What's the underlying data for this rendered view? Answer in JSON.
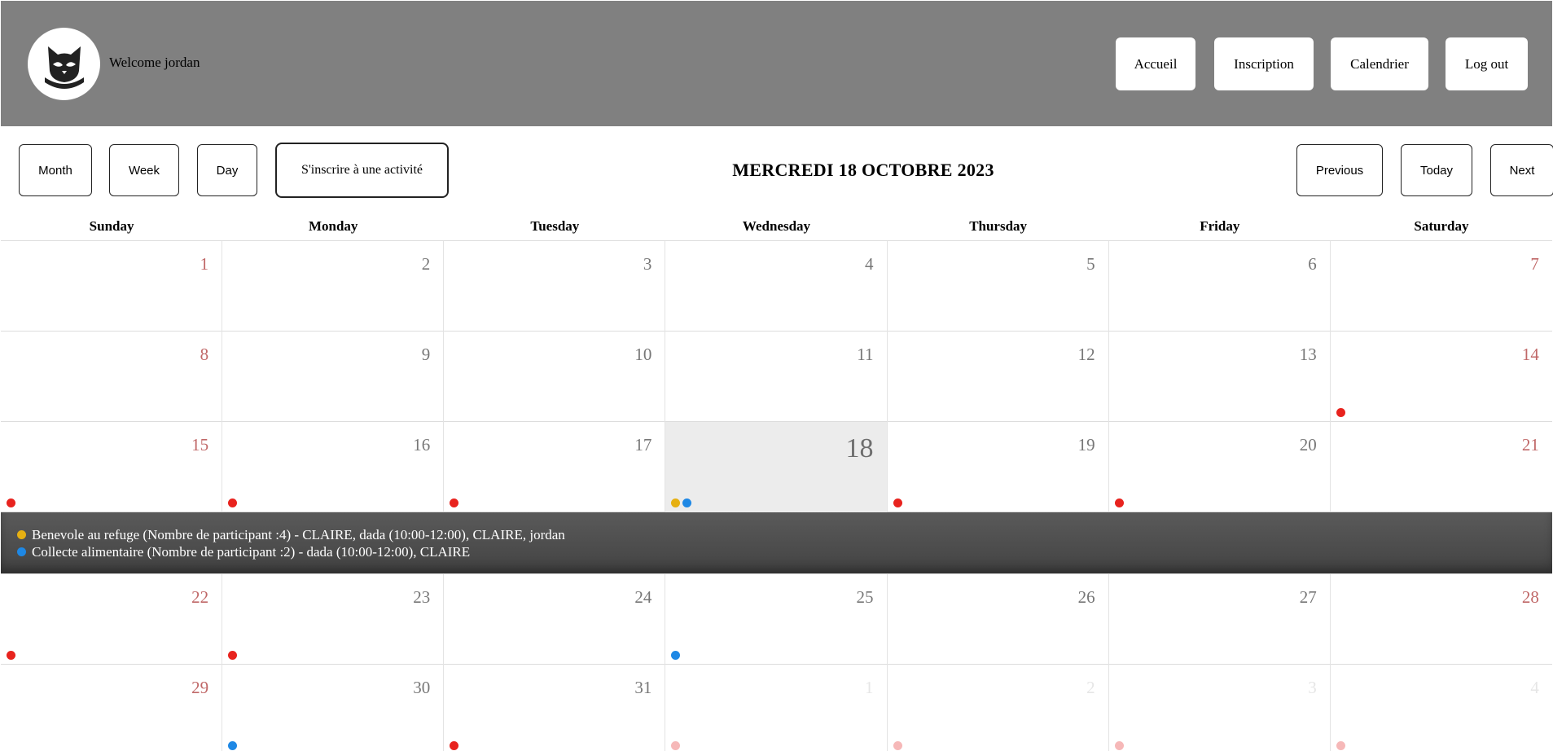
{
  "header": {
    "welcome": "Welcome jordan",
    "nav": [
      "Accueil",
      "Inscription",
      "Calendrier",
      "Log out"
    ]
  },
  "toolbar": {
    "month": "Month",
    "week": "Week",
    "day": "Day",
    "subscribe": "S'inscrire à une activité",
    "title": "MERCREDI 18 OCTOBRE 2023",
    "previous": "Previous",
    "today": "Today",
    "next": "Next"
  },
  "weekdays": [
    "Sunday",
    "Monday",
    "Tuesday",
    "Wednesday",
    "Thursday",
    "Friday",
    "Saturday"
  ],
  "colors": {
    "red": "#e8231e",
    "yellow": "#e6b012",
    "blue": "#1e88e5",
    "pink": "#f6b8b8"
  },
  "weeks": [
    {
      "days": [
        {
          "n": "1",
          "dots": []
        },
        {
          "n": "2",
          "dots": []
        },
        {
          "n": "3",
          "dots": []
        },
        {
          "n": "4",
          "dots": []
        },
        {
          "n": "5",
          "dots": []
        },
        {
          "n": "6",
          "dots": []
        },
        {
          "n": "7",
          "dots": []
        }
      ]
    },
    {
      "days": [
        {
          "n": "8",
          "dots": []
        },
        {
          "n": "9",
          "dots": []
        },
        {
          "n": "10",
          "dots": []
        },
        {
          "n": "11",
          "dots": []
        },
        {
          "n": "12",
          "dots": []
        },
        {
          "n": "13",
          "dots": []
        },
        {
          "n": "14",
          "dots": [
            "red"
          ]
        }
      ]
    },
    {
      "days": [
        {
          "n": "15",
          "dots": [
            "red"
          ]
        },
        {
          "n": "16",
          "dots": [
            "red"
          ]
        },
        {
          "n": "17",
          "dots": [
            "red"
          ]
        },
        {
          "n": "18",
          "dots": [
            "yellow",
            "blue"
          ],
          "today": true
        },
        {
          "n": "19",
          "dots": [
            "red"
          ]
        },
        {
          "n": "20",
          "dots": [
            "red"
          ]
        },
        {
          "n": "21",
          "dots": []
        }
      ],
      "details": [
        {
          "color": "yellow",
          "text": "Benevole au refuge (Nombre de participant :4) - CLAIRE, dada (10:00-12:00), CLAIRE, jordan"
        },
        {
          "color": "blue",
          "text": "Collecte alimentaire (Nombre de participant :2) - dada (10:00-12:00), CLAIRE"
        }
      ]
    },
    {
      "days": [
        {
          "n": "22",
          "dots": [
            "red"
          ]
        },
        {
          "n": "23",
          "dots": [
            "red"
          ]
        },
        {
          "n": "24",
          "dots": []
        },
        {
          "n": "25",
          "dots": [
            "blue"
          ]
        },
        {
          "n": "26",
          "dots": []
        },
        {
          "n": "27",
          "dots": []
        },
        {
          "n": "28",
          "dots": []
        }
      ]
    },
    {
      "days": [
        {
          "n": "29",
          "dots": []
        },
        {
          "n": "30",
          "dots": [
            "blue"
          ]
        },
        {
          "n": "31",
          "dots": [
            "red"
          ]
        },
        {
          "n": "1",
          "dots": [
            "pink"
          ],
          "other": true
        },
        {
          "n": "2",
          "dots": [
            "pink"
          ],
          "other": true
        },
        {
          "n": "3",
          "dots": [
            "pink"
          ],
          "other": true
        },
        {
          "n": "4",
          "dots": [
            "pink"
          ],
          "other": true
        }
      ]
    }
  ]
}
